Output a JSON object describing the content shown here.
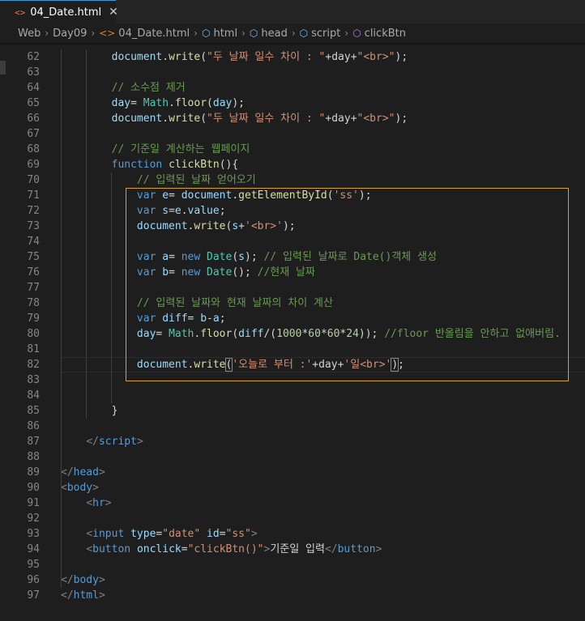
{
  "tab": {
    "icon": "html-file-icon",
    "label": "04_Date.html",
    "close": "✕"
  },
  "breadcrumb": [
    {
      "label": "Web",
      "icon": null
    },
    {
      "label": "Day09",
      "icon": null
    },
    {
      "label": "04_Date.html",
      "icon": "html-file-icon"
    },
    {
      "label": "html",
      "icon": "element-cube-icon"
    },
    {
      "label": "head",
      "icon": "element-cube-icon"
    },
    {
      "label": "script",
      "icon": "element-cube-icon"
    },
    {
      "label": "clickBtn",
      "icon": "method-cube-icon"
    }
  ],
  "colors": {
    "selection_border": "#d7a22a",
    "tab_border": "#3c9bd6"
  },
  "lines": [
    {
      "n": "62",
      "tokens": [
        [
          "        ",
          ""
        ],
        [
          "document",
          "var"
        ],
        [
          ".",
          ""
        ],
        [
          "write",
          "fn"
        ],
        [
          "(",
          ""
        ],
        [
          "\"두 날짜 일수 차이 : \"",
          "str"
        ],
        [
          "+day+",
          ""
        ],
        [
          "\"<br>\"",
          "str"
        ],
        [
          ");",
          ""
        ]
      ]
    },
    {
      "n": "63",
      "tokens": []
    },
    {
      "n": "64",
      "tokens": [
        [
          "        ",
          ""
        ],
        [
          "// 소수점 제거",
          "com"
        ]
      ]
    },
    {
      "n": "65",
      "tokens": [
        [
          "        ",
          ""
        ],
        [
          "day",
          "var"
        ],
        [
          "= ",
          ""
        ],
        [
          "Math",
          "cls"
        ],
        [
          ".",
          ""
        ],
        [
          "floor",
          "fn"
        ],
        [
          "(",
          ""
        ],
        [
          "day",
          "var"
        ],
        [
          ");",
          ""
        ]
      ]
    },
    {
      "n": "66",
      "tokens": [
        [
          "        ",
          ""
        ],
        [
          "document",
          "var"
        ],
        [
          ".",
          ""
        ],
        [
          "write",
          "fn"
        ],
        [
          "(",
          ""
        ],
        [
          "\"두 날짜 일수 차이 : \"",
          "str"
        ],
        [
          "+day+",
          ""
        ],
        [
          "\"<br>\"",
          "str"
        ],
        [
          ");",
          ""
        ]
      ]
    },
    {
      "n": "67",
      "tokens": []
    },
    {
      "n": "68",
      "tokens": [
        [
          "        ",
          ""
        ],
        [
          "// 기준일 계산하는 웹페이지",
          "com"
        ]
      ]
    },
    {
      "n": "69",
      "tokens": [
        [
          "        ",
          ""
        ],
        [
          "function",
          "kw"
        ],
        [
          " ",
          ""
        ],
        [
          "clickBtn",
          "fn"
        ],
        [
          "(){",
          ""
        ]
      ]
    },
    {
      "n": "70",
      "tokens": [
        [
          "            ",
          ""
        ],
        [
          "// 입력된 날짜 얻어오기",
          "com"
        ]
      ]
    },
    {
      "n": "71",
      "tokens": [
        [
          "            ",
          ""
        ],
        [
          "var",
          "kw"
        ],
        [
          " ",
          ""
        ],
        [
          "e",
          "var"
        ],
        [
          "= ",
          ""
        ],
        [
          "document",
          "var"
        ],
        [
          ".",
          ""
        ],
        [
          "getElementById",
          "fn"
        ],
        [
          "(",
          ""
        ],
        [
          "'ss'",
          "str"
        ],
        [
          ");",
          ""
        ]
      ]
    },
    {
      "n": "72",
      "tokens": [
        [
          "            ",
          ""
        ],
        [
          "var",
          "kw"
        ],
        [
          " ",
          ""
        ],
        [
          "s",
          "var"
        ],
        [
          "=",
          ""
        ],
        [
          "e",
          "var"
        ],
        [
          ".",
          ""
        ],
        [
          "value",
          "var"
        ],
        [
          ";",
          ""
        ]
      ]
    },
    {
      "n": "73",
      "tokens": [
        [
          "            ",
          ""
        ],
        [
          "document",
          "var"
        ],
        [
          ".",
          ""
        ],
        [
          "write",
          "fn"
        ],
        [
          "(",
          ""
        ],
        [
          "s",
          "var"
        ],
        [
          "+",
          ""
        ],
        [
          "'<br>'",
          "str"
        ],
        [
          ");",
          ""
        ]
      ]
    },
    {
      "n": "74",
      "tokens": []
    },
    {
      "n": "75",
      "tokens": [
        [
          "            ",
          ""
        ],
        [
          "var",
          "kw"
        ],
        [
          " ",
          ""
        ],
        [
          "a",
          "var"
        ],
        [
          "= ",
          ""
        ],
        [
          "new",
          "kw"
        ],
        [
          " ",
          ""
        ],
        [
          "Date",
          "cls"
        ],
        [
          "(",
          ""
        ],
        [
          "s",
          "var"
        ],
        [
          "); ",
          ""
        ],
        [
          "// 입력된 날짜로 Date()객체 생성",
          "com"
        ]
      ]
    },
    {
      "n": "76",
      "tokens": [
        [
          "            ",
          ""
        ],
        [
          "var",
          "kw"
        ],
        [
          " ",
          ""
        ],
        [
          "b",
          "var"
        ],
        [
          "= ",
          ""
        ],
        [
          "new",
          "kw"
        ],
        [
          " ",
          ""
        ],
        [
          "Date",
          "cls"
        ],
        [
          "(); ",
          ""
        ],
        [
          "//현재 날짜",
          "com"
        ]
      ]
    },
    {
      "n": "77",
      "tokens": []
    },
    {
      "n": "78",
      "tokens": [
        [
          "            ",
          ""
        ],
        [
          "// 입력된 날짜와 현재 날짜의 차이 계산",
          "com"
        ]
      ]
    },
    {
      "n": "79",
      "tokens": [
        [
          "            ",
          ""
        ],
        [
          "var",
          "kw"
        ],
        [
          " ",
          ""
        ],
        [
          "diff",
          "var"
        ],
        [
          "= ",
          ""
        ],
        [
          "b",
          "var"
        ],
        [
          "-",
          ""
        ],
        [
          "a",
          "var"
        ],
        [
          ";",
          ""
        ]
      ]
    },
    {
      "n": "80",
      "tokens": [
        [
          "            ",
          ""
        ],
        [
          "day",
          "var"
        ],
        [
          "= ",
          ""
        ],
        [
          "Math",
          "cls"
        ],
        [
          ".",
          ""
        ],
        [
          "floor",
          "fn"
        ],
        [
          "(",
          ""
        ],
        [
          "diff",
          "var"
        ],
        [
          "/(",
          ""
        ],
        [
          "1000",
          "num"
        ],
        [
          "*",
          ""
        ],
        [
          "60",
          "num"
        ],
        [
          "*",
          ""
        ],
        [
          "60",
          "num"
        ],
        [
          "*",
          ""
        ],
        [
          "24",
          "num"
        ],
        [
          ")); ",
          ""
        ],
        [
          "//floor 반올림을 안하고 없애버림.",
          "com"
        ]
      ]
    },
    {
      "n": "81",
      "tokens": []
    },
    {
      "n": "82",
      "tokens": [
        [
          "            ",
          ""
        ],
        [
          "document",
          "var"
        ],
        [
          ".",
          ""
        ],
        [
          "write",
          "fn"
        ],
        [
          "(",
          "bm"
        ],
        [
          "'오늘로 부터 :'",
          "str"
        ],
        [
          "+day+",
          ""
        ],
        [
          "'일<br>'",
          "str"
        ],
        [
          ")",
          "bm"
        ],
        [
          ";",
          ""
        ]
      ]
    },
    {
      "n": "83",
      "tokens": []
    },
    {
      "n": "84",
      "tokens": []
    },
    {
      "n": "85",
      "tokens": [
        [
          "        ",
          ""
        ],
        [
          "}",
          ""
        ]
      ]
    },
    {
      "n": "86",
      "tokens": []
    },
    {
      "n": "87",
      "tokens": [
        [
          "    ",
          ""
        ],
        [
          "</",
          "br"
        ],
        [
          "script",
          "tag"
        ],
        [
          ">",
          "br"
        ]
      ]
    },
    {
      "n": "88",
      "tokens": []
    },
    {
      "n": "89",
      "tokens": [
        [
          "</",
          "br"
        ],
        [
          "head",
          "tag"
        ],
        [
          ">",
          "br"
        ]
      ]
    },
    {
      "n": "90",
      "tokens": [
        [
          "<",
          "br"
        ],
        [
          "body",
          "tag"
        ],
        [
          ">",
          "br"
        ]
      ]
    },
    {
      "n": "91",
      "tokens": [
        [
          "    ",
          ""
        ],
        [
          "<",
          "br"
        ],
        [
          "hr",
          "tag"
        ],
        [
          ">",
          "br"
        ]
      ]
    },
    {
      "n": "92",
      "tokens": []
    },
    {
      "n": "93",
      "tokens": [
        [
          "    ",
          ""
        ],
        [
          "<",
          "br"
        ],
        [
          "input",
          "tag"
        ],
        [
          " ",
          ""
        ],
        [
          "type",
          "attr"
        ],
        [
          "=",
          ""
        ],
        [
          "\"date\"",
          "str"
        ],
        [
          " ",
          ""
        ],
        [
          "id",
          "attr"
        ],
        [
          "=",
          ""
        ],
        [
          "\"ss\"",
          "str"
        ],
        [
          ">",
          "br"
        ]
      ]
    },
    {
      "n": "94",
      "tokens": [
        [
          "    ",
          ""
        ],
        [
          "<",
          "br"
        ],
        [
          "button",
          "tag"
        ],
        [
          " ",
          ""
        ],
        [
          "onclick",
          "attr"
        ],
        [
          "=",
          ""
        ],
        [
          "\"clickBtn()\"",
          "str"
        ],
        [
          ">",
          "br"
        ],
        [
          "기준일 입력",
          "txt"
        ],
        [
          "</",
          "br"
        ],
        [
          "button",
          "tag"
        ],
        [
          ">",
          "br"
        ]
      ]
    },
    {
      "n": "95",
      "tokens": []
    },
    {
      "n": "96",
      "tokens": [
        [
          "</",
          "br"
        ],
        [
          "body",
          "tag"
        ],
        [
          ">",
          "br"
        ]
      ]
    },
    {
      "n": "97",
      "tokens": [
        [
          "</",
          "br"
        ],
        [
          "html",
          "tag"
        ],
        [
          ">",
          "br"
        ]
      ]
    }
  ]
}
